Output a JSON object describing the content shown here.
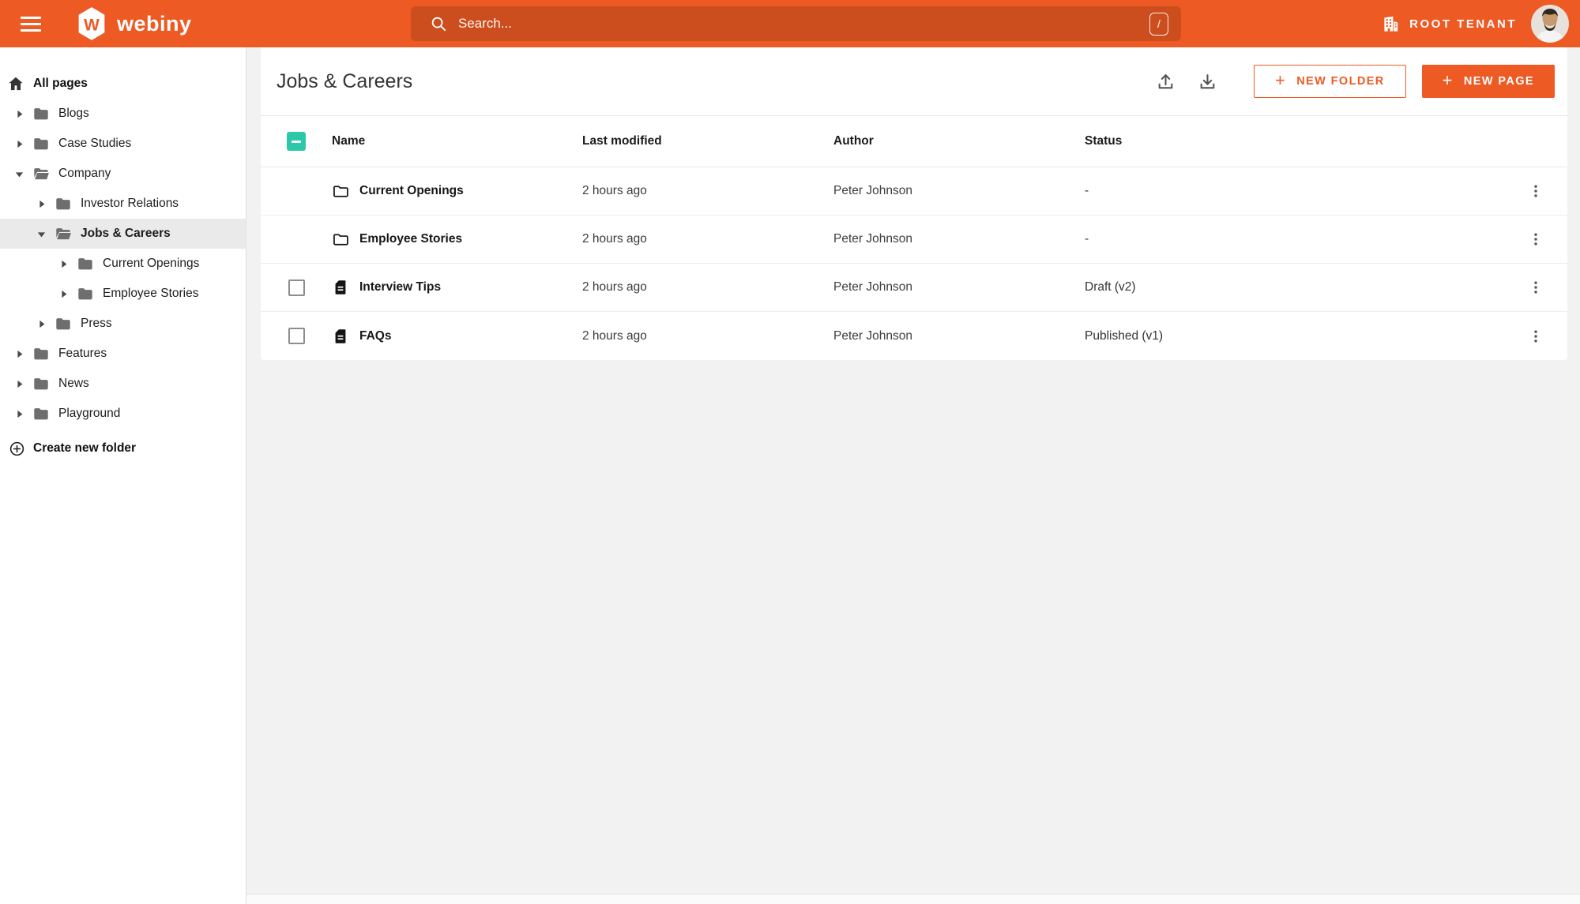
{
  "colors": {
    "accent_orange": "#EE5A24",
    "checkbox_teal": "#2DC7A9",
    "selected_gray": "#EAEAEA"
  },
  "topbar": {
    "logo_text": "webiny",
    "search": {
      "placeholder": "Search...",
      "shortcut": "/"
    },
    "tenant_label": "ROOT TENANT"
  },
  "sidebar": {
    "root_label": "All pages",
    "items": [
      {
        "label": "Blogs",
        "level": 0,
        "expanded": false,
        "selected": false
      },
      {
        "label": "Case Studies",
        "level": 0,
        "expanded": false,
        "selected": false
      },
      {
        "label": "Company",
        "level": 0,
        "expanded": true,
        "selected": false
      },
      {
        "label": "Investor Relations",
        "level": 1,
        "expanded": false,
        "selected": false
      },
      {
        "label": "Jobs & Careers",
        "level": 1,
        "expanded": true,
        "selected": true
      },
      {
        "label": "Current Openings",
        "level": 2,
        "expanded": false,
        "selected": false
      },
      {
        "label": "Employee Stories",
        "level": 2,
        "expanded": false,
        "selected": false
      },
      {
        "label": "Press",
        "level": 1,
        "expanded": false,
        "selected": false
      },
      {
        "label": "Features",
        "level": 0,
        "expanded": false,
        "selected": false
      },
      {
        "label": "News",
        "level": 0,
        "expanded": false,
        "selected": false
      },
      {
        "label": "Playground",
        "level": 0,
        "expanded": false,
        "selected": false
      }
    ],
    "create_folder_label": "Create new folder"
  },
  "main": {
    "title": "Jobs & Careers",
    "buttons": {
      "new_folder": "NEW FOLDER",
      "new_page": "NEW PAGE"
    },
    "table": {
      "columns": [
        "Name",
        "Last modified",
        "Author",
        "Status"
      ],
      "header_checkbox": "indeterminate",
      "rows": [
        {
          "type": "folder",
          "name": "Current Openings",
          "modified": "2 hours ago",
          "author": "Peter Johnson",
          "status": "-",
          "selected": false
        },
        {
          "type": "folder",
          "name": "Employee Stories",
          "modified": "2 hours ago",
          "author": "Peter Johnson",
          "status": "-",
          "selected": false
        },
        {
          "type": "page",
          "name": "Interview Tips",
          "modified": "2 hours ago",
          "author": "Peter Johnson",
          "status": "Draft (v2)",
          "selected": false
        },
        {
          "type": "page",
          "name": "FAQs",
          "modified": "2 hours ago",
          "author": "Peter Johnson",
          "status": "Published (v1)",
          "selected": false
        }
      ]
    }
  },
  "icons": {
    "menu": "hamburger",
    "logo": "webiny-hexagon-w",
    "search": "magnifier",
    "shortcut_badge": "slash-key",
    "tenant": "building",
    "avatar": "user-photo",
    "home": "house",
    "caret_collapsed": "triangle-right",
    "caret_expanded": "triangle-down",
    "sidebar_folder": "folder-filled",
    "sidebar_folder_open": "folder-open-filled",
    "create_folder": "circle-plus",
    "import": "upload-arrow",
    "export": "download-arrow",
    "button_plus": "+",
    "row_folder": "folder-outline",
    "row_page": "document-lines",
    "row_actions": "kebab-vertical-dots",
    "header_checkbox": "indeterminate-dash"
  }
}
